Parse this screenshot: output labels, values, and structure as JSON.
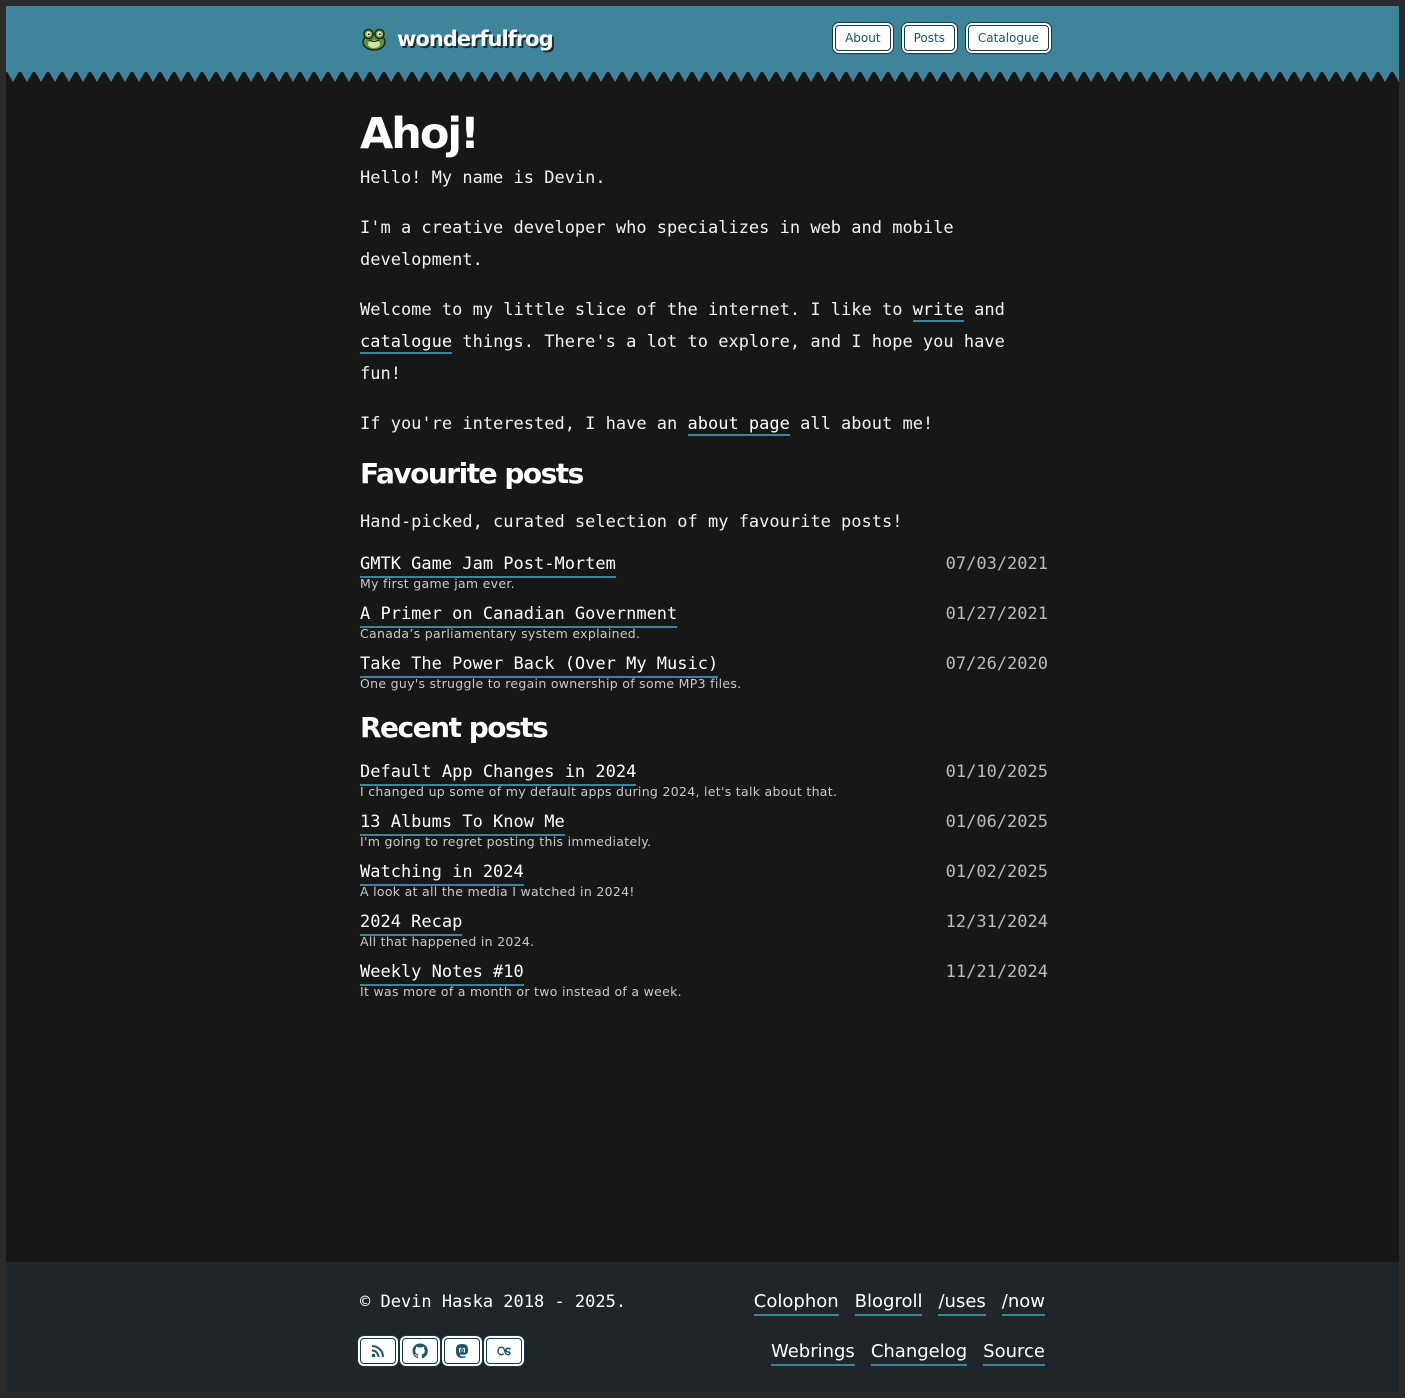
{
  "site": {
    "name": "wonderfulfrog",
    "nav": [
      {
        "label": "About"
      },
      {
        "label": "Posts"
      },
      {
        "label": "Catalogue"
      }
    ]
  },
  "colors": {
    "accent": "#3e849b",
    "background": "#171718",
    "footer": "#1f2529"
  },
  "intro": {
    "heading": "Ahoj!",
    "p1": "Hello! My name is Devin.",
    "p2": "I'm a creative developer who specializes in web and mobile development.",
    "p3_before": "Welcome to my little slice of the internet. I like to ",
    "p3_link1": "write",
    "p3_mid": " and ",
    "p3_link2": "catalogue",
    "p3_after": " things. There's a lot to explore, and I hope you have fun!",
    "p4_before": "If you're interested, I have an ",
    "p4_link": "about page",
    "p4_after": " all about me!"
  },
  "favourites": {
    "heading": "Favourite posts",
    "description": "Hand-picked, curated selection of my favourite posts!",
    "posts": [
      {
        "title": "GMTK Game Jam Post-Mortem",
        "desc": "My first game jam ever.",
        "date": "07/03/2021"
      },
      {
        "title": "A Primer on Canadian Government",
        "desc": "Canada’s parliamentary system explained.",
        "date": "01/27/2021"
      },
      {
        "title": "Take The Power Back (Over My Music)",
        "desc": "One guy's struggle to regain ownership of some MP3 files.",
        "date": "07/26/2020"
      }
    ]
  },
  "recent": {
    "heading": "Recent posts",
    "posts": [
      {
        "title": "Default App Changes in 2024",
        "desc": "I changed up some of my default apps during 2024, let's talk about that.",
        "date": "01/10/2025"
      },
      {
        "title": "13 Albums To Know Me",
        "desc": "I'm going to regret posting this immediately.",
        "date": "01/06/2025"
      },
      {
        "title": "Watching in 2024",
        "desc": "A look at all the media I watched in 2024!",
        "date": "01/02/2025"
      },
      {
        "title": "2024 Recap",
        "desc": "All that happened in 2024.",
        "date": "12/31/2024"
      },
      {
        "title": "Weekly Notes #10",
        "desc": "It was more of a month or two instead of a week.",
        "date": "11/21/2024"
      }
    ]
  },
  "footer": {
    "copyright": "© Devin Haska 2018 - 2025.",
    "links_row1": [
      "Colophon",
      "Blogroll",
      "/uses",
      "/now"
    ],
    "links_row2": [
      "Webrings",
      "Changelog",
      "Source"
    ],
    "socials": [
      {
        "icon": "rss-icon"
      },
      {
        "icon": "github-icon"
      },
      {
        "icon": "mastodon-icon"
      },
      {
        "icon": "lastfm-icon"
      }
    ]
  }
}
